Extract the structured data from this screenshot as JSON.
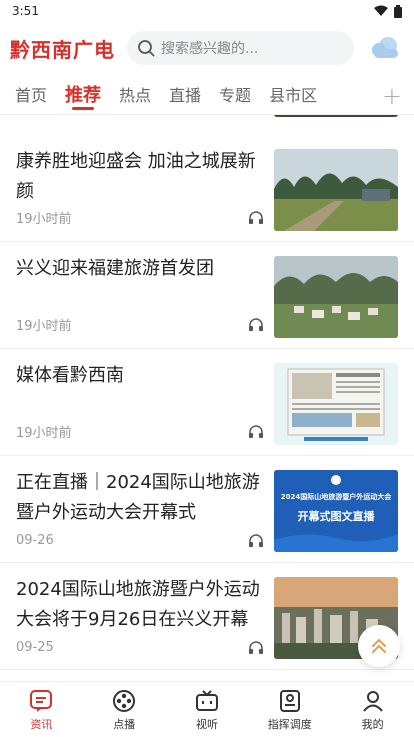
{
  "status": {
    "time": "3:51"
  },
  "header": {
    "logo": "黔西南广电",
    "search_placeholder": "搜索感兴趣的..."
  },
  "tabs": [
    {
      "label": "首页",
      "active": false
    },
    {
      "label": "推荐",
      "active": true
    },
    {
      "label": "热点",
      "active": false
    },
    {
      "label": "直播",
      "active": false
    },
    {
      "label": "专题",
      "active": false
    },
    {
      "label": "县市区",
      "active": false
    }
  ],
  "tab_more": "+",
  "feed": [
    {
      "title": "康养胜地迎盛会 加油之城展新颜",
      "time": "19小时前",
      "thumb": "mountains"
    },
    {
      "title": "兴义迎来福建旅游首发团",
      "time": "19小时前",
      "thumb": "village"
    },
    {
      "title": "媒体看黔西南",
      "time": "19小时前",
      "thumb": "newspaper"
    },
    {
      "title": "正在直播｜2024国际山地旅游暨户外运动大会开幕式",
      "time": "09-26",
      "thumb": "live",
      "thumb_text": {
        "line1": "2024国际山地旅游暨户外运动大会",
        "line2": "开幕式图文直播"
      }
    },
    {
      "title": "2024国际山地旅游暨户外运动大会将于9月26日在兴义开幕",
      "time": "09-25",
      "thumb": "city"
    }
  ],
  "bottom_nav": [
    {
      "label": "资讯",
      "icon": "news-icon",
      "active": true
    },
    {
      "label": "点播",
      "icon": "film-reel-icon",
      "active": false
    },
    {
      "label": "视听",
      "icon": "tv-icon",
      "active": false
    },
    {
      "label": "指挥调度",
      "icon": "dispatch-icon",
      "active": false
    },
    {
      "label": "我的",
      "icon": "user-icon",
      "active": false
    }
  ],
  "colors": {
    "accent": "#d9302b",
    "live_blue": "#1f5fb8"
  }
}
